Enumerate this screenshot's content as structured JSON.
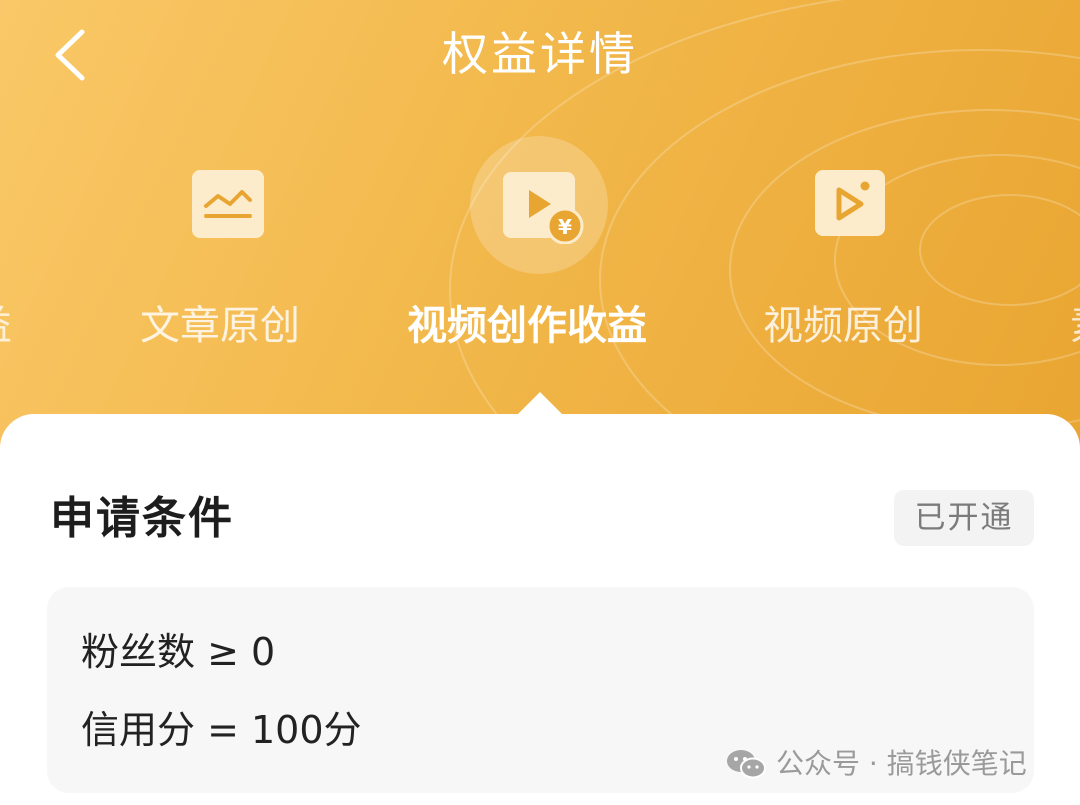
{
  "header": {
    "title": "权益详情"
  },
  "tabs": [
    {
      "label": "文章原创",
      "icon": "article-chart-icon",
      "active": false
    },
    {
      "label": "视频创作收益",
      "icon": "video-income-icon",
      "active": true
    },
    {
      "label": "视频原创",
      "icon": "video-original-icon",
      "active": false
    }
  ],
  "edge_tabs": {
    "left_glyph": "益",
    "right_glyph": "素"
  },
  "content": {
    "section_title": "申请条件",
    "status": "已开通",
    "conditions": [
      "粉丝数 ≥ 0",
      "信用分 = 100分"
    ]
  },
  "watermark": {
    "text": "公众号 · 搞钱侠笔记"
  },
  "colors": {
    "header_gradient_start": "#fac868",
    "header_gradient_end": "#e9a531",
    "icon_tile": "#fdeccc",
    "icon_symbol": "#e9a532"
  }
}
